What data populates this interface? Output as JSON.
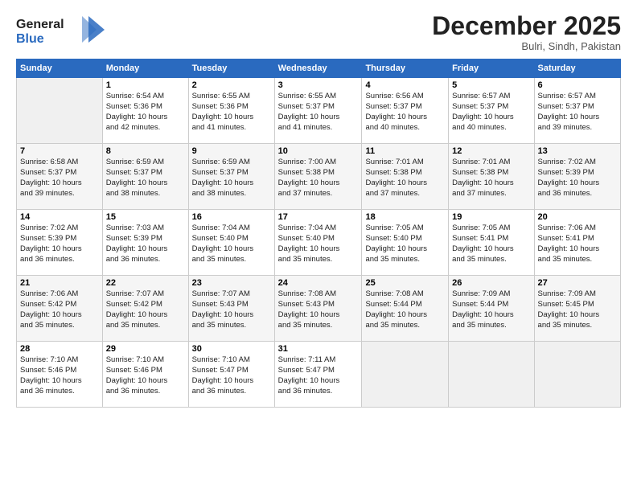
{
  "logo": {
    "line1": "General",
    "line2": "Blue"
  },
  "title": "December 2025",
  "location": "Bulri, Sindh, Pakistan",
  "weekdays": [
    "Sunday",
    "Monday",
    "Tuesday",
    "Wednesday",
    "Thursday",
    "Friday",
    "Saturday"
  ],
  "weeks": [
    [
      {
        "day": "",
        "info": ""
      },
      {
        "day": "1",
        "info": "Sunrise: 6:54 AM\nSunset: 5:36 PM\nDaylight: 10 hours\nand 42 minutes."
      },
      {
        "day": "2",
        "info": "Sunrise: 6:55 AM\nSunset: 5:36 PM\nDaylight: 10 hours\nand 41 minutes."
      },
      {
        "day": "3",
        "info": "Sunrise: 6:55 AM\nSunset: 5:37 PM\nDaylight: 10 hours\nand 41 minutes."
      },
      {
        "day": "4",
        "info": "Sunrise: 6:56 AM\nSunset: 5:37 PM\nDaylight: 10 hours\nand 40 minutes."
      },
      {
        "day": "5",
        "info": "Sunrise: 6:57 AM\nSunset: 5:37 PM\nDaylight: 10 hours\nand 40 minutes."
      },
      {
        "day": "6",
        "info": "Sunrise: 6:57 AM\nSunset: 5:37 PM\nDaylight: 10 hours\nand 39 minutes."
      }
    ],
    [
      {
        "day": "7",
        "info": "Sunrise: 6:58 AM\nSunset: 5:37 PM\nDaylight: 10 hours\nand 39 minutes."
      },
      {
        "day": "8",
        "info": "Sunrise: 6:59 AM\nSunset: 5:37 PM\nDaylight: 10 hours\nand 38 minutes."
      },
      {
        "day": "9",
        "info": "Sunrise: 6:59 AM\nSunset: 5:37 PM\nDaylight: 10 hours\nand 38 minutes."
      },
      {
        "day": "10",
        "info": "Sunrise: 7:00 AM\nSunset: 5:38 PM\nDaylight: 10 hours\nand 37 minutes."
      },
      {
        "day": "11",
        "info": "Sunrise: 7:01 AM\nSunset: 5:38 PM\nDaylight: 10 hours\nand 37 minutes."
      },
      {
        "day": "12",
        "info": "Sunrise: 7:01 AM\nSunset: 5:38 PM\nDaylight: 10 hours\nand 37 minutes."
      },
      {
        "day": "13",
        "info": "Sunrise: 7:02 AM\nSunset: 5:39 PM\nDaylight: 10 hours\nand 36 minutes."
      }
    ],
    [
      {
        "day": "14",
        "info": "Sunrise: 7:02 AM\nSunset: 5:39 PM\nDaylight: 10 hours\nand 36 minutes."
      },
      {
        "day": "15",
        "info": "Sunrise: 7:03 AM\nSunset: 5:39 PM\nDaylight: 10 hours\nand 36 minutes."
      },
      {
        "day": "16",
        "info": "Sunrise: 7:04 AM\nSunset: 5:40 PM\nDaylight: 10 hours\nand 35 minutes."
      },
      {
        "day": "17",
        "info": "Sunrise: 7:04 AM\nSunset: 5:40 PM\nDaylight: 10 hours\nand 35 minutes."
      },
      {
        "day": "18",
        "info": "Sunrise: 7:05 AM\nSunset: 5:40 PM\nDaylight: 10 hours\nand 35 minutes."
      },
      {
        "day": "19",
        "info": "Sunrise: 7:05 AM\nSunset: 5:41 PM\nDaylight: 10 hours\nand 35 minutes."
      },
      {
        "day": "20",
        "info": "Sunrise: 7:06 AM\nSunset: 5:41 PM\nDaylight: 10 hours\nand 35 minutes."
      }
    ],
    [
      {
        "day": "21",
        "info": "Sunrise: 7:06 AM\nSunset: 5:42 PM\nDaylight: 10 hours\nand 35 minutes."
      },
      {
        "day": "22",
        "info": "Sunrise: 7:07 AM\nSunset: 5:42 PM\nDaylight: 10 hours\nand 35 minutes."
      },
      {
        "day": "23",
        "info": "Sunrise: 7:07 AM\nSunset: 5:43 PM\nDaylight: 10 hours\nand 35 minutes."
      },
      {
        "day": "24",
        "info": "Sunrise: 7:08 AM\nSunset: 5:43 PM\nDaylight: 10 hours\nand 35 minutes."
      },
      {
        "day": "25",
        "info": "Sunrise: 7:08 AM\nSunset: 5:44 PM\nDaylight: 10 hours\nand 35 minutes."
      },
      {
        "day": "26",
        "info": "Sunrise: 7:09 AM\nSunset: 5:44 PM\nDaylight: 10 hours\nand 35 minutes."
      },
      {
        "day": "27",
        "info": "Sunrise: 7:09 AM\nSunset: 5:45 PM\nDaylight: 10 hours\nand 35 minutes."
      }
    ],
    [
      {
        "day": "28",
        "info": "Sunrise: 7:10 AM\nSunset: 5:46 PM\nDaylight: 10 hours\nand 36 minutes."
      },
      {
        "day": "29",
        "info": "Sunrise: 7:10 AM\nSunset: 5:46 PM\nDaylight: 10 hours\nand 36 minutes."
      },
      {
        "day": "30",
        "info": "Sunrise: 7:10 AM\nSunset: 5:47 PM\nDaylight: 10 hours\nand 36 minutes."
      },
      {
        "day": "31",
        "info": "Sunrise: 7:11 AM\nSunset: 5:47 PM\nDaylight: 10 hours\nand 36 minutes."
      },
      {
        "day": "",
        "info": ""
      },
      {
        "day": "",
        "info": ""
      },
      {
        "day": "",
        "info": ""
      }
    ]
  ]
}
